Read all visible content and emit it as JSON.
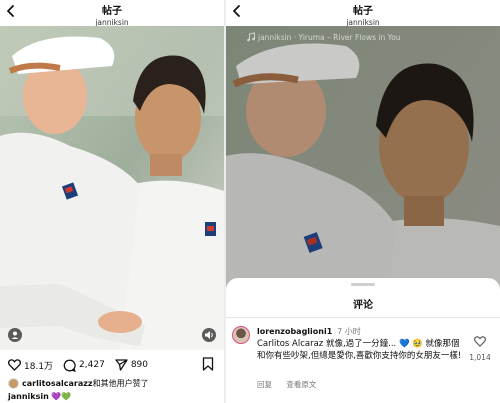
{
  "left": {
    "header": {
      "title": "帖子",
      "username": "janniksin"
    },
    "actions": {
      "likes": "18.1万",
      "comments": "2,427",
      "shares": "890"
    },
    "liked_by": {
      "user": "carlitosalcarazz",
      "text": " 和其他用户赞了"
    },
    "caption": {
      "user": "janniksin",
      "text": " 💜💚"
    }
  },
  "right": {
    "header": {
      "title": "帖子",
      "username": "janniksin"
    },
    "music": "janniksin · Yiruma – River Flows in You",
    "sheet": {
      "title": "评论",
      "comment": {
        "user": "lorenzobaglioni1",
        "time": "7 小时",
        "text": "Carlitos Alcaraz 就像,過了一分鐘... 💙 🥹 就像那個和你有些吵架,但總是愛你,喜歡你支持你的女朋友一樣!",
        "reply": "回复",
        "translate": "查看原文",
        "likes": "1,014"
      }
    }
  },
  "icons": [
    "back-icon",
    "heart-icon",
    "comment-icon",
    "share-icon",
    "bookmark-icon",
    "profile-tag-icon",
    "mute-icon",
    "music-icon"
  ],
  "colors": {
    "accent_story_ring": "#e14a8a",
    "text": "#111111",
    "muted": "#777777"
  }
}
